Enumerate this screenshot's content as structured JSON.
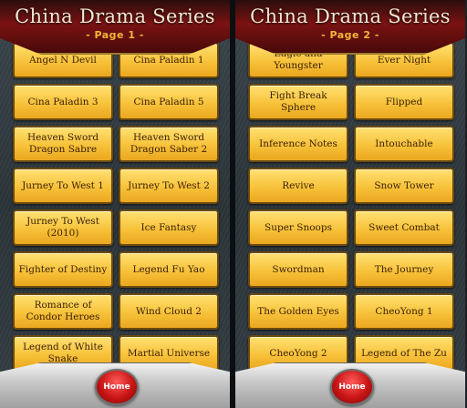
{
  "pages": [
    {
      "title": "China Drama Series",
      "subtitle": "- Page 1 -",
      "items": [
        "Angel N Devil",
        "Cina Paladin 1",
        "Cina Paladin 3",
        "Cina Paladin 5",
        "Heaven Sword Dragon Sabre",
        "Heaven Sword Dragon Saber 2",
        "Jurney To West 1",
        "Jurney To West 2",
        "Jurney To West (2010)",
        "Ice Fantasy",
        "Fighter of Destiny",
        "Legend Fu Yao",
        "Romance of Condor Heroes",
        "Wind Cloud 2",
        "Legend of White Snake",
        "Martial Universe"
      ],
      "home_label": "Home"
    },
    {
      "title": "China Drama Series",
      "subtitle": "- Page 2 -",
      "items": [
        "Eagle and Youngster",
        "Ever Night",
        "Fight Break Sphere",
        "Flipped",
        "Inference Notes",
        "Intouchable",
        "Revive",
        "Snow Tower",
        "Super Snoops",
        "Sweet Combat",
        "Swordman",
        "The Journey",
        "The Golden Eyes",
        "CheoYong 1",
        "CheoYong 2",
        "Legend of The Zu"
      ],
      "home_label": "Home"
    }
  ]
}
